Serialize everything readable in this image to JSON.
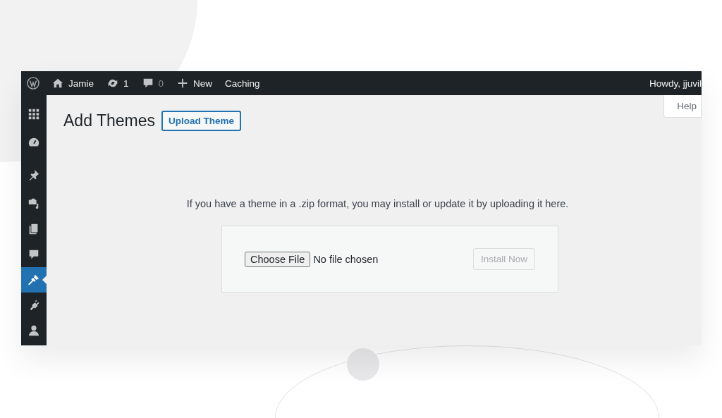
{
  "admin_bar": {
    "items": [
      {
        "kind": "logo"
      },
      {
        "kind": "home",
        "label": "Jamie"
      },
      {
        "kind": "updates",
        "label": "1"
      },
      {
        "kind": "comments",
        "label": "0"
      },
      {
        "kind": "new",
        "label": "New"
      },
      {
        "kind": "text",
        "label": "Caching"
      }
    ],
    "account": "Howdy, jjuvil"
  },
  "sidebar": {
    "items": [
      {
        "kind": "grid",
        "selected": false
      },
      {
        "kind": "dashboard",
        "selected": false
      },
      {
        "kind": "pin",
        "selected": false
      },
      {
        "kind": "media",
        "selected": false
      },
      {
        "kind": "pages",
        "selected": false
      },
      {
        "kind": "comment",
        "selected": false
      },
      {
        "kind": "brush",
        "selected": true
      },
      {
        "kind": "plug",
        "selected": false
      },
      {
        "kind": "user",
        "selected": false
      }
    ]
  },
  "help_tab": {
    "label": "Help"
  },
  "page": {
    "title": "Add Themes",
    "action": "Upload Theme"
  },
  "upload": {
    "description": "If you have a theme in a .zip format, you may install or update it by uploading it here.",
    "choose_button": "Choose File",
    "file_status": "No file chosen",
    "install_button": {
      "label": "Install Now",
      "disabled": true
    }
  }
}
